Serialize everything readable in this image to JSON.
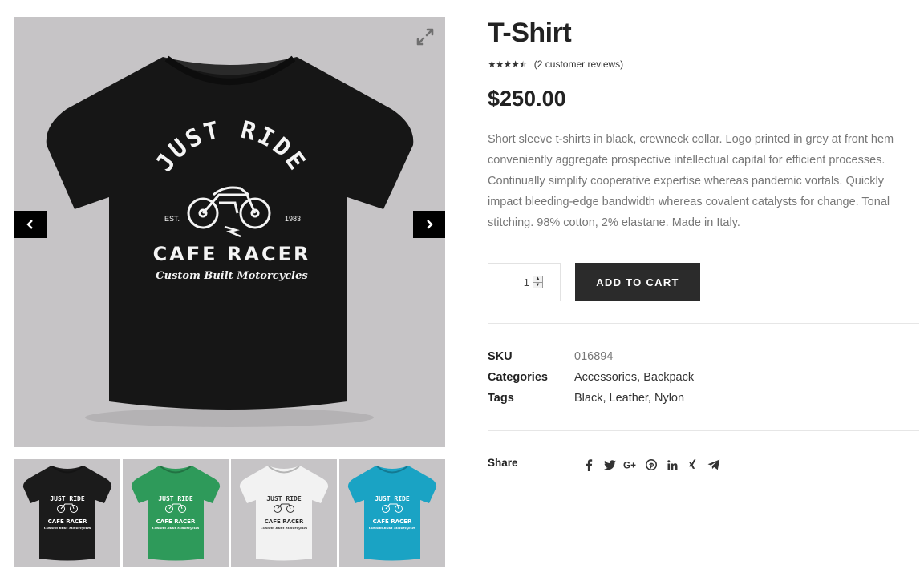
{
  "gallery": {
    "main_logo": {
      "line1": "JUST RIDE",
      "est": "EST.",
      "year": "1983",
      "line2": "CAFE RACER",
      "line3": "Custom Built Motorcycles"
    },
    "thumbnails": [
      {
        "name": "thumb-black",
        "shirt_color": "#1b1b1b",
        "bg": "#c6c4c6",
        "print_color": "#ffffff"
      },
      {
        "name": "thumb-green",
        "shirt_color": "#2e9a5a",
        "bg": "#c6c4c6",
        "print_color": "#ffffff"
      },
      {
        "name": "thumb-white",
        "shirt_color": "#f2f2f2",
        "bg": "#c6c4c6",
        "print_color": "#333333"
      },
      {
        "name": "thumb-cyan",
        "shirt_color": "#1aa3c4",
        "bg": "#c6c4c6",
        "print_color": "#ffffff"
      }
    ],
    "icons": {
      "zoom": "expand-icon",
      "prev": "chevron-left-icon",
      "next": "chevron-right-icon"
    }
  },
  "product": {
    "title": "T-Shirt",
    "rating": {
      "value": 4.5,
      "max": 5,
      "stars": "★★★★★",
      "reviews_label": "(2 customer reviews)"
    },
    "price": "$250.00",
    "description": "Short sleeve t-shirts in black, crewneck collar. Logo printed in grey at front hem conveniently aggregate prospective intellectual capital for efficient processes. Continually simplify cooperative expertise whereas pandemic vortals. Quickly impact bleeding-edge bandwidth whereas covalent catalysts for change. Tonal stitching. 98% cotton, 2% elastane. Made in Italy.",
    "quantity": "1",
    "add_to_cart_label": "ADD TO CART"
  },
  "meta": {
    "sku_label": "SKU",
    "sku_value": "016894",
    "categories_label": "Categories",
    "categories": [
      "Accessories",
      "Backpack"
    ],
    "tags_label": "Tags",
    "tags": [
      "Black",
      "Leather",
      "Nylon"
    ],
    "separator": ", "
  },
  "share": {
    "label": "Share",
    "icons": [
      "facebook-icon",
      "twitter-icon",
      "google-plus-icon",
      "pinterest-icon",
      "linkedin-icon",
      "xing-icon",
      "telegram-icon"
    ]
  },
  "colors": {
    "accent_dark": "#2b2b2b",
    "text_muted": "#777777",
    "gallery_bg": "#c6c4c6"
  }
}
